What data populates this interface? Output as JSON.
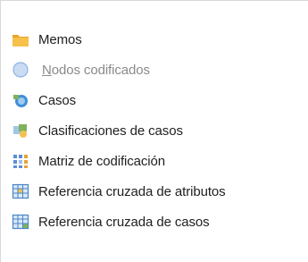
{
  "menu": {
    "items": [
      {
        "label": "Memos",
        "icon": "folder-memos-icon",
        "color": "#f0b33a"
      },
      {
        "label": "Nodos codificados",
        "mnemonic": "N",
        "rest": "odos codificados",
        "icon": "nodes-circle-icon",
        "color": "#a9c8ee",
        "disabled": true
      },
      {
        "label": "Casos",
        "icon": "cases-icon",
        "color": "#3f8fd8"
      },
      {
        "label": "Clasificaciones de casos",
        "icon": "case-classifications-icon",
        "color": "#7fb25c"
      },
      {
        "label": "Matriz de codificación",
        "icon": "coding-matrix-icon",
        "color": "#5b8ed6"
      },
      {
        "label": "Referencia cruzada de atributos",
        "icon": "attribute-crosstab-icon",
        "color": "#4a86c8"
      },
      {
        "label": "Referencia cruzada de casos",
        "icon": "case-crosstab-icon",
        "color": "#4a86c8"
      }
    ]
  }
}
